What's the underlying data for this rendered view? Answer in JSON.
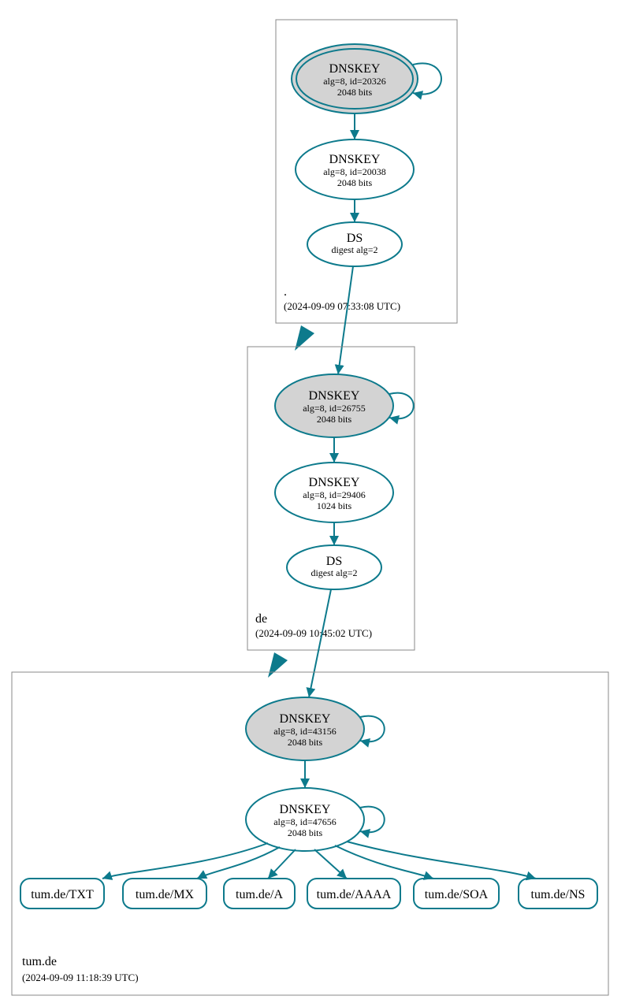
{
  "colors": {
    "accent": "#0d7a8c",
    "shaded": "#d3d3d3"
  },
  "zones": [
    {
      "name": ".",
      "timestamp": "(2024-09-09 07:33:08 UTC)",
      "nodes": [
        {
          "id": "root-ksk",
          "type": "dnskey",
          "title": "DNSKEY",
          "line1": "alg=8, id=20326",
          "line2": "2048 bits",
          "shaded": true,
          "double": true,
          "selfloop": true
        },
        {
          "id": "root-zsk",
          "type": "dnskey",
          "title": "DNSKEY",
          "line1": "alg=8, id=20038",
          "line2": "2048 bits",
          "shaded": false,
          "double": false,
          "selfloop": false
        },
        {
          "id": "root-ds",
          "type": "ds",
          "title": "DS",
          "line1": "digest alg=2"
        }
      ]
    },
    {
      "name": "de",
      "timestamp": "(2024-09-09 10:45:02 UTC)",
      "nodes": [
        {
          "id": "de-ksk",
          "type": "dnskey",
          "title": "DNSKEY",
          "line1": "alg=8, id=26755",
          "line2": "2048 bits",
          "shaded": true,
          "double": false,
          "selfloop": true
        },
        {
          "id": "de-zsk",
          "type": "dnskey",
          "title": "DNSKEY",
          "line1": "alg=8, id=29406",
          "line2": "1024 bits",
          "shaded": false,
          "double": false,
          "selfloop": false
        },
        {
          "id": "de-ds",
          "type": "ds",
          "title": "DS",
          "line1": "digest alg=2"
        }
      ]
    },
    {
      "name": "tum.de",
      "timestamp": "(2024-09-09 11:18:39 UTC)",
      "nodes": [
        {
          "id": "tum-ksk",
          "type": "dnskey",
          "title": "DNSKEY",
          "line1": "alg=8, id=43156",
          "line2": "2048 bits",
          "shaded": true,
          "double": false,
          "selfloop": true
        },
        {
          "id": "tum-zsk",
          "type": "dnskey",
          "title": "DNSKEY",
          "line1": "alg=8, id=47656",
          "line2": "2048 bits",
          "shaded": false,
          "double": false,
          "selfloop": true
        }
      ],
      "records": [
        "tum.de/TXT",
        "tum.de/MX",
        "tum.de/A",
        "tum.de/AAAA",
        "tum.de/SOA",
        "tum.de/NS"
      ]
    }
  ]
}
